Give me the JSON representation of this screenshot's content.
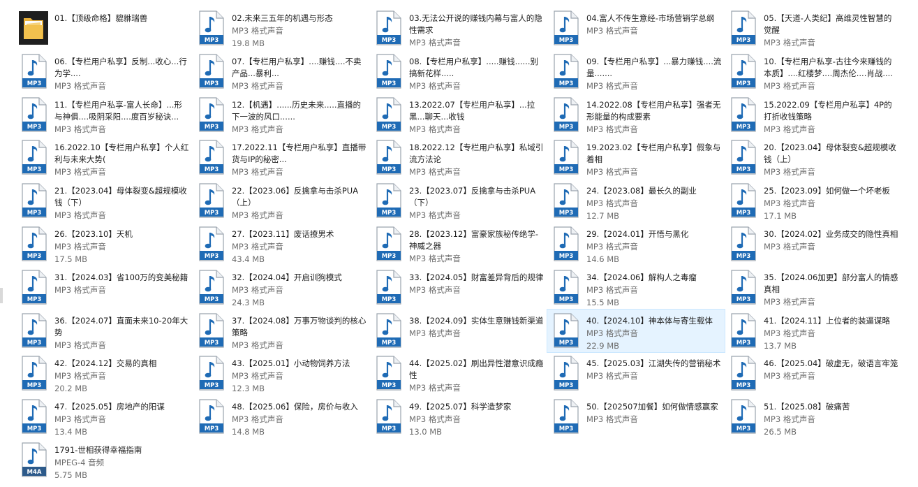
{
  "colors": {
    "selected_bg": "#e5f3ff",
    "mp3_badge": "#1f6bb5",
    "m4a_badge": "#2d5a8a",
    "folder": "#f2c14e"
  },
  "items": [
    {
      "name": "01.【顶级命格】貔貅瑞兽",
      "type": "",
      "size": "",
      "icon": "folder-icon",
      "badge": ""
    },
    {
      "name": "02.未来三五年的机遇与形态",
      "type": "MP3 格式声音",
      "size": "19.8 MB",
      "icon": "mp3-icon",
      "badge": "MP3"
    },
    {
      "name": "03.无法公开说的赚钱内幕与富人的隐性需求",
      "type": "MP3 格式声音",
      "size": "",
      "icon": "mp3-icon",
      "badge": "MP3"
    },
    {
      "name": "04.富人不传生意经-市场营销学总纲",
      "type": "MP3 格式声音",
      "size": "",
      "icon": "mp3-icon",
      "badge": "MP3"
    },
    {
      "name": "05.【天道-人类纪】高维灵性智慧的觉醒",
      "type": "MP3 格式声音",
      "size": "",
      "icon": "mp3-icon",
      "badge": "MP3"
    },
    {
      "name": "06.【专栏用户私享】反制...收心...行为学....",
      "type": "MP3 格式声音",
      "size": "",
      "icon": "mp3-icon",
      "badge": "MP3"
    },
    {
      "name": "07.【专栏用户私享】....赚钱....不卖产品...暴利...",
      "type": "MP3 格式声音",
      "size": "",
      "icon": "mp3-icon",
      "badge": "MP3"
    },
    {
      "name": "08.【专栏用户私享】.....赚钱......别搞新花样.....",
      "type": "MP3 格式声音",
      "size": "",
      "icon": "mp3-icon",
      "badge": "MP3"
    },
    {
      "name": "09.【专栏用户私享】...暴力赚钱....流量.......",
      "type": "MP3 格式声音",
      "size": "",
      "icon": "mp3-icon",
      "badge": "MP3"
    },
    {
      "name": "10.【专栏用户私享-古往今来赚钱的本质】....红楼梦....周杰伦....肖战....",
      "type": "MP3 格式声音",
      "size": "",
      "icon": "mp3-icon",
      "badge": "MP3"
    },
    {
      "name": "11.【专栏用户私享-富人长命】...形与神俱....吸阴采阳....度百岁秘诀...",
      "type": "MP3 格式声音",
      "size": "",
      "icon": "mp3-icon",
      "badge": "MP3"
    },
    {
      "name": "12.【机遇】......历史未来.....直播的下一波的风口......",
      "type": "MP3 格式声音",
      "size": "",
      "icon": "mp3-icon",
      "badge": "MP3"
    },
    {
      "name": "13.2022.07【专栏用户私享】...拉黑...聊天...收钱",
      "type": "MP3 格式声音",
      "size": "",
      "icon": "mp3-icon",
      "badge": "MP3"
    },
    {
      "name": "14.2022.08【专栏用户私享】强者无形能量的构成要素",
      "type": "MP3 格式声音",
      "size": "",
      "icon": "mp3-icon",
      "badge": "MP3"
    },
    {
      "name": "15.2022.09【专栏用户私享】4P的打折收钱策略",
      "type": "MP3 格式声音",
      "size": "",
      "icon": "mp3-icon",
      "badge": "MP3"
    },
    {
      "name": "16.2022.10【专栏用户私享】个人红利与未来大势(",
      "type": "MP3 格式声音",
      "size": "",
      "icon": "mp3-icon",
      "badge": "MP3"
    },
    {
      "name": "17.2022.11【专栏用户私享】直播带货与IP的秘密...",
      "type": "MP3 格式声音",
      "size": "",
      "icon": "mp3-icon",
      "badge": "MP3"
    },
    {
      "name": "18.2022.12【专栏用户私享】私域引流方法论",
      "type": "MP3 格式声音",
      "size": "",
      "icon": "mp3-icon",
      "badge": "MP3"
    },
    {
      "name": "19.2023.02【专栏用户私享】假象与着相",
      "type": "MP3 格式声音",
      "size": "",
      "icon": "mp3-icon",
      "badge": "MP3"
    },
    {
      "name": "20.【2023.04】母体裂变&超规模收钱（上）",
      "type": "MP3 格式声音",
      "size": "",
      "icon": "mp3-icon",
      "badge": "MP3"
    },
    {
      "name": "21.【2023.04】母体裂变&超规模收钱（下）",
      "type": "MP3 格式声音",
      "size": "",
      "icon": "mp3-icon",
      "badge": "MP3"
    },
    {
      "name": "22.【2023.06】反擒拿与击杀PUA（上）",
      "type": "MP3 格式声音",
      "size": "",
      "icon": "mp3-icon",
      "badge": "MP3"
    },
    {
      "name": "23.【2023.07】反擒拿与击杀PUA（下）",
      "type": "MP3 格式声音",
      "size": "",
      "icon": "mp3-icon",
      "badge": "MP3"
    },
    {
      "name": "24.【2023.08】最长久的副业",
      "type": "MP3 格式声音",
      "size": "12.7 MB",
      "icon": "mp3-icon",
      "badge": "MP3"
    },
    {
      "name": "25.【2023.09】如何做一个坏老板",
      "type": "MP3 格式声音",
      "size": "17.1 MB",
      "icon": "mp3-icon",
      "badge": "MP3"
    },
    {
      "name": "26.【2023.10】天机",
      "type": "MP3 格式声音",
      "size": "17.5 MB",
      "icon": "mp3-icon",
      "badge": "MP3"
    },
    {
      "name": "27.【2023.11】废话撩男术",
      "type": "MP3 格式声音",
      "size": "43.4 MB",
      "icon": "mp3-icon",
      "badge": "MP3"
    },
    {
      "name": "28.【2023.12】富豪家族秘传绝学-神威之器",
      "type": "MP3 格式声音",
      "size": "",
      "icon": "mp3-icon",
      "badge": "MP3"
    },
    {
      "name": "29.【2024.01】开悟与黑化",
      "type": "MP3 格式声音",
      "size": "14.6 MB",
      "icon": "mp3-icon",
      "badge": "MP3"
    },
    {
      "name": "30.【2024.02】业务成交的隐性真相",
      "type": "MP3 格式声音",
      "size": "",
      "icon": "mp3-icon",
      "badge": "MP3"
    },
    {
      "name": "31.【2024.03】省100万的变美秘籍",
      "type": "MP3 格式声音",
      "size": "",
      "icon": "mp3-icon",
      "badge": "MP3"
    },
    {
      "name": "32.【2024.04】开启训狗模式",
      "type": "MP3 格式声音",
      "size": "24.3 MB",
      "icon": "mp3-icon",
      "badge": "MP3"
    },
    {
      "name": "33.【2024.05】财富差异背后的规律",
      "type": "MP3 格式声音",
      "size": "",
      "icon": "mp3-icon",
      "badge": "MP3"
    },
    {
      "name": "34.【2024.06】解构人之毒瘤",
      "type": "MP3 格式声音",
      "size": "15.5 MB",
      "icon": "mp3-icon",
      "badge": "MP3"
    },
    {
      "name": "35.【2024.06加更】部分富人的情感真相",
      "type": "MP3 格式声音",
      "size": "",
      "icon": "mp3-icon",
      "badge": "MP3"
    },
    {
      "name": "36.【2024.07】直面未来10-20年大势",
      "type": "MP3 格式声音",
      "size": "",
      "icon": "mp3-icon",
      "badge": "MP3"
    },
    {
      "name": "37.【2024.08】万事万物谈判的核心策略",
      "type": "MP3 格式声音",
      "size": "",
      "icon": "mp3-icon",
      "badge": "MP3"
    },
    {
      "name": "38.【2024.09】实体生意赚钱新渠道",
      "type": "MP3 格式声音",
      "size": "",
      "icon": "mp3-icon",
      "badge": "MP3"
    },
    {
      "name": "40.【2024.10】神本体与寄生载体",
      "type": "MP3 格式声音",
      "size": "22.9 MB",
      "icon": "mp3-icon",
      "badge": "MP3",
      "selected": true
    },
    {
      "name": "41.【2024.11】上位者的装逼谋略",
      "type": "MP3 格式声音",
      "size": "13.7 MB",
      "icon": "mp3-icon",
      "badge": "MP3"
    },
    {
      "name": "42.【2024.12】交易的真相",
      "type": "MP3 格式声音",
      "size": "20.2 MB",
      "icon": "mp3-icon",
      "badge": "MP3"
    },
    {
      "name": "43.【2025.01】小动物饲养方法",
      "type": "MP3 格式声音",
      "size": "12.3 MB",
      "icon": "mp3-icon",
      "badge": "MP3"
    },
    {
      "name": "44.【2025.02】刷出异性潜意识成瘾性",
      "type": "MP3 格式声音",
      "size": "",
      "icon": "mp3-icon",
      "badge": "MP3"
    },
    {
      "name": "45.【2025.03】江湖失传的营销秘术",
      "type": "MP3 格式声音",
      "size": "",
      "icon": "mp3-icon",
      "badge": "MP3"
    },
    {
      "name": "46.【2025.04】破虚无，破语言牢笼",
      "type": "MP3 格式声音",
      "size": "",
      "icon": "mp3-icon",
      "badge": "MP3"
    },
    {
      "name": "47.【2025.05】房地产的阳谋",
      "type": "MP3 格式声音",
      "size": "13.4 MB",
      "icon": "mp3-icon",
      "badge": "MP3"
    },
    {
      "name": "48.【2025.06】保险，房价与收入",
      "type": "MP3 格式声音",
      "size": "14.8 MB",
      "icon": "mp3-icon",
      "badge": "MP3"
    },
    {
      "name": "49.【2025.07】科学造梦家",
      "type": "MP3 格式声音",
      "size": "13.0 MB",
      "icon": "mp3-icon",
      "badge": "MP3"
    },
    {
      "name": "50.【202507加餐】如何做情感赢家",
      "type": "MP3 格式声音",
      "size": "",
      "icon": "mp3-icon",
      "badge": "MP3"
    },
    {
      "name": "51.【2025.08】破痛苦",
      "type": "MP3 格式声音",
      "size": "26.5 MB",
      "icon": "mp3-icon",
      "badge": "MP3"
    },
    {
      "name": "1791-世相获得幸福指南",
      "type": "MPEG-4 音频",
      "size": "5.75 MB",
      "icon": "m4a-icon",
      "badge": "M4A"
    }
  ]
}
